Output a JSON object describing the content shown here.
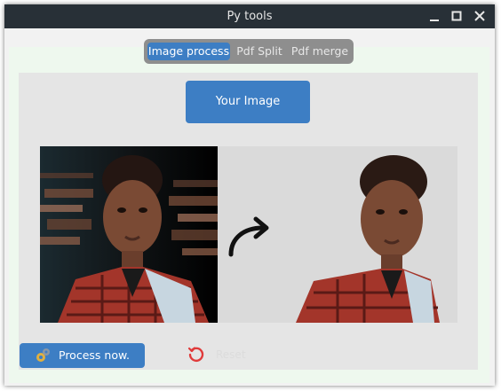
{
  "window": {
    "title": "Py tools"
  },
  "tabs": [
    {
      "label": "Image process",
      "active": true
    },
    {
      "label": "Pdf Split",
      "active": false
    },
    {
      "label": "Pdf merge",
      "active": false
    }
  ],
  "main": {
    "your_image_label": "Your Image",
    "process_label": "Process now.",
    "reset_label": "Reset",
    "icons": [
      "minimize-icon",
      "maximize-icon",
      "close-icon",
      "curved-arrow-icon",
      "gears-icon",
      "reset-icon"
    ]
  },
  "colors": {
    "accent": "#3d7ec4",
    "titlebar": "#283037",
    "reset_red": "#e03a3a"
  }
}
